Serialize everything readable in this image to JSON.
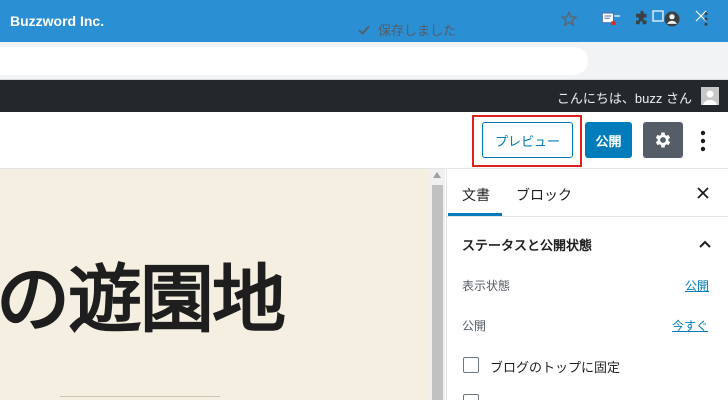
{
  "browser": {
    "title": "Buzzword Inc."
  },
  "adminbar": {
    "greeting": "こんにちは、buzz さん"
  },
  "header": {
    "saved_status": "保存しました",
    "preview_label": "プレビュー",
    "publish_label": "公開"
  },
  "canvas": {
    "heading": "の遊園地"
  },
  "sidebar": {
    "tabs": [
      {
        "label": "文書"
      },
      {
        "label": "ブロック"
      }
    ],
    "panel_title": "ステータスと公開状態",
    "visibility_label": "表示状態",
    "visibility_value": "公開",
    "publish_label": "公開",
    "publish_value": "今すぐ",
    "sticky_label": "ブログのトップに固定"
  },
  "colors": {
    "accent": "#007cba",
    "titlebar": "#2b8fd4",
    "adminbar": "#23282d",
    "highlight": "#e0201c"
  }
}
